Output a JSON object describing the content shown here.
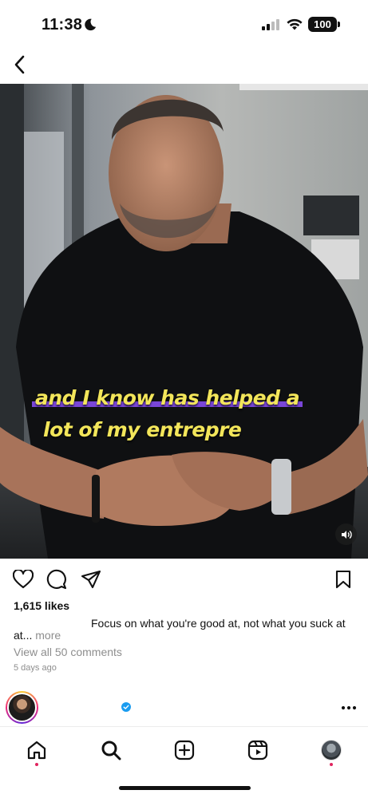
{
  "status_bar": {
    "time": "11:38",
    "battery": "100",
    "icons": [
      "moon-icon",
      "signal-icon",
      "wifi-icon"
    ]
  },
  "header": {
    "back_icon": "chevron-left-icon"
  },
  "video": {
    "caption_line1": "and I know has helped a",
    "caption_line2": "lot of my entrepre",
    "mute_icon": "speaker-icon",
    "caption_color": "#f3e65a",
    "caption_highlight_color": "#7a46d8"
  },
  "post": {
    "action_icons": [
      "heart-icon",
      "comment-icon",
      "share-icon",
      "bookmark-icon"
    ],
    "likes": "1,615 likes",
    "caption_part1": "Focus on what you're good at, not what you suck at",
    "caption_part2": "at...",
    "more_label": "more",
    "comments_link": "View all 50 comments",
    "date": "5 days ago"
  },
  "next_post": {
    "verified_icon": "verified-badge-icon",
    "more_icon": "more-horizontal-icon"
  },
  "bottom_nav": {
    "items": [
      "home-icon",
      "search-icon",
      "create-icon",
      "reels-icon",
      "profile-avatar"
    ],
    "notification_dot_color": "#e0245e"
  }
}
